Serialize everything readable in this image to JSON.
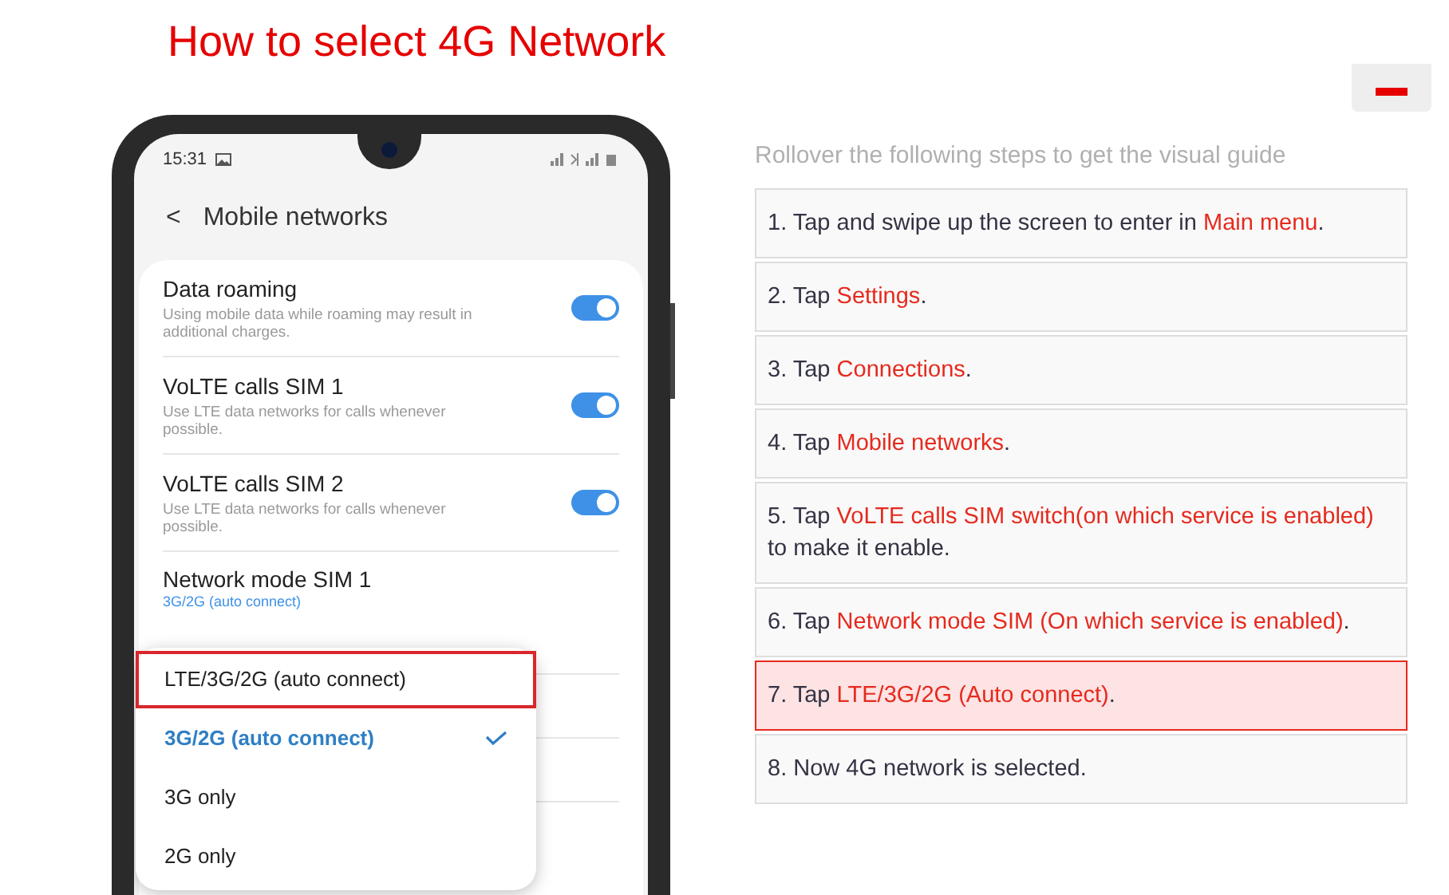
{
  "page_title": "How to select 4G Network",
  "phone": {
    "status_bar": {
      "time": "15:31"
    },
    "header": {
      "back": "<",
      "title": "Mobile networks"
    },
    "settings": [
      {
        "title": "Data roaming",
        "description": "Using mobile data while roaming may result in additional charges.",
        "on": true
      },
      {
        "title": "VoLTE calls SIM 1",
        "description": "Use LTE data networks for calls whenever possible.",
        "on": true
      },
      {
        "title": "VoLTE calls SIM 2",
        "description": "Use LTE data networks for calls whenever possible.",
        "on": true
      }
    ],
    "network_mode": {
      "title": "Network mode SIM 1",
      "value": "3G/2G (auto connect)"
    },
    "dropdown": [
      {
        "label": "LTE/3G/2G (auto connect)",
        "selected": false,
        "highlighted": true
      },
      {
        "label": "3G/2G (auto connect)",
        "selected": true,
        "highlighted": false
      },
      {
        "label": "3G only",
        "selected": false,
        "highlighted": false
      },
      {
        "label": "2G only",
        "selected": false,
        "highlighted": false
      }
    ]
  },
  "guide": {
    "intro": "Rollover the following steps to get the visual guide",
    "steps": [
      {
        "selected": false,
        "parts": [
          {
            "kind": "plain",
            "text": "1. Tap and swipe up the screen to enter in "
          },
          {
            "kind": "highlight",
            "text": "Main menu"
          },
          {
            "kind": "plain",
            "text": "."
          }
        ]
      },
      {
        "selected": false,
        "parts": [
          {
            "kind": "plain",
            "text": "2. Tap "
          },
          {
            "kind": "highlight",
            "text": "Settings"
          },
          {
            "kind": "plain",
            "text": "."
          }
        ]
      },
      {
        "selected": false,
        "parts": [
          {
            "kind": "plain",
            "text": "3. Tap "
          },
          {
            "kind": "highlight",
            "text": "Connections"
          },
          {
            "kind": "plain",
            "text": "."
          }
        ]
      },
      {
        "selected": false,
        "parts": [
          {
            "kind": "plain",
            "text": "4. Tap "
          },
          {
            "kind": "highlight",
            "text": "Mobile networks"
          },
          {
            "kind": "plain",
            "text": "."
          }
        ]
      },
      {
        "selected": false,
        "parts": [
          {
            "kind": "plain",
            "text": "5. Tap "
          },
          {
            "kind": "highlight",
            "text": "VoLTE calls SIM switch(on which service is enabled)"
          },
          {
            "kind": "plain",
            "text": " to make it enable."
          }
        ]
      },
      {
        "selected": false,
        "parts": [
          {
            "kind": "plain",
            "text": "6. Tap "
          },
          {
            "kind": "highlight",
            "text": "Network mode SIM (On which service is enabled)"
          },
          {
            "kind": "plain",
            "text": "."
          }
        ]
      },
      {
        "selected": true,
        "parts": [
          {
            "kind": "plain",
            "text": "7. Tap "
          },
          {
            "kind": "highlight",
            "text": "LTE/3G/2G (Auto connect)"
          },
          {
            "kind": "plain",
            "text": "."
          }
        ]
      },
      {
        "selected": false,
        "parts": [
          {
            "kind": "plain",
            "text": "8. Now 4G network is selected."
          }
        ]
      }
    ]
  }
}
